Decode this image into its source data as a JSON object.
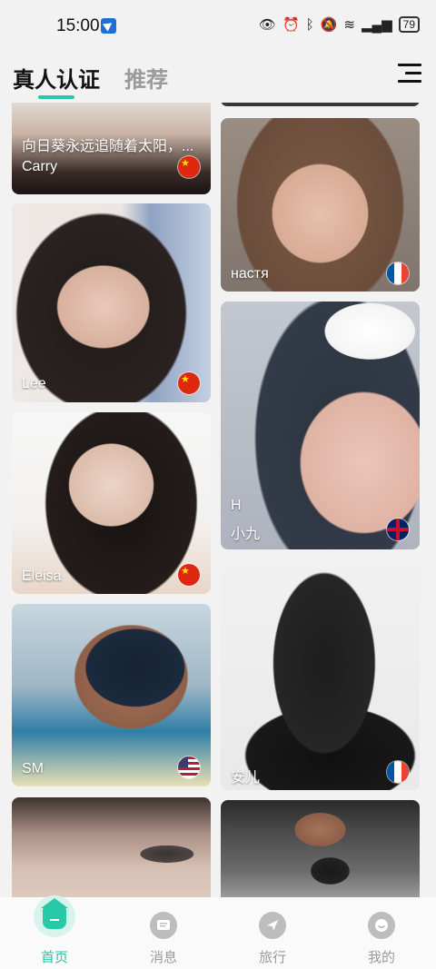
{
  "status": {
    "time": "15:00",
    "battery": "79"
  },
  "header": {
    "tabs": [
      {
        "label": "真人认证"
      },
      {
        "label": "推荐"
      }
    ]
  },
  "cards": [
    {
      "name": "Carry",
      "desc": "向日葵永远追随着太阳，...",
      "flag": "cn"
    },
    {
      "name": "Lee",
      "flag": "cn"
    },
    {
      "name": "Eleisa",
      "flag": "cn"
    },
    {
      "name": "SM",
      "flag": "us"
    },
    {
      "name": "",
      "flag": ""
    },
    {
      "name": "",
      "flag": ""
    },
    {
      "name": "настя",
      "flag": "fr"
    },
    {
      "sub": "H",
      "name": "小九",
      "flag": "uk"
    },
    {
      "name": "安儿",
      "flag": "fr"
    },
    {
      "name": "",
      "flag": ""
    }
  ],
  "nav": [
    {
      "label": "首页",
      "icon": "home-icon",
      "active": true
    },
    {
      "label": "消息",
      "icon": "message-icon",
      "active": false
    },
    {
      "label": "旅行",
      "icon": "travel-icon",
      "active": false
    },
    {
      "label": "我的",
      "icon": "profile-icon",
      "active": false
    }
  ],
  "colors": {
    "accent": "#27c9a9"
  }
}
